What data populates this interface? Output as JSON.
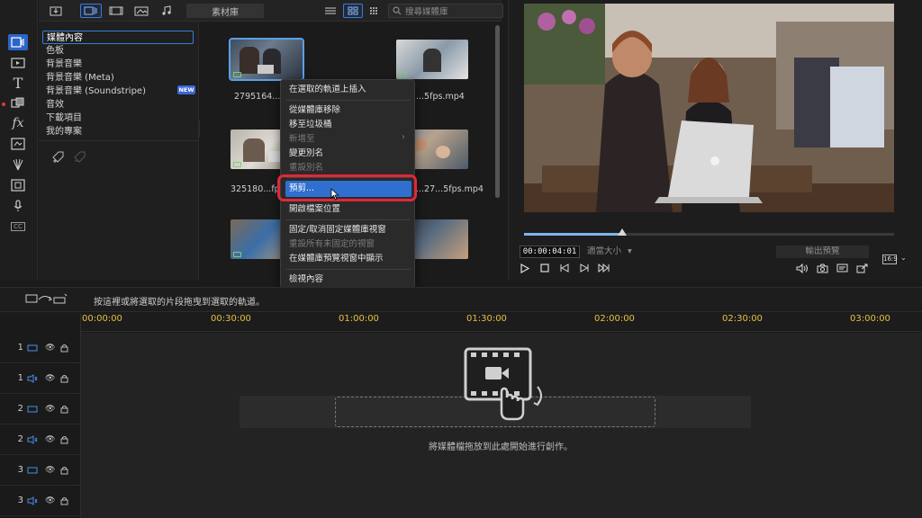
{
  "media_toolbar": {
    "library_label": "素材庫",
    "search_placeholder": "搜尋媒體庫"
  },
  "tree": {
    "items": [
      "媒體內容",
      "色板",
      "背景音樂",
      "背景音樂 (Meta)",
      "背景音樂 (Soundstripe)",
      "音效",
      "下載項目",
      "我的專案"
    ],
    "badge": "NEW"
  },
  "media": {
    "labels": [
      "2795164...fp",
      "...5fps.mp4",
      "325180...fps",
      "...27...5fps.mp4"
    ]
  },
  "context_menu": {
    "items": [
      {
        "label": "在選取的軌道上插入",
        "disabled": false
      },
      {
        "label": "從媒體庫移除",
        "disabled": false
      },
      {
        "label": "移至垃圾桶",
        "disabled": false
      },
      {
        "label": "新增至",
        "disabled": true
      },
      {
        "label": "變更別名",
        "disabled": false
      },
      {
        "label": "重設別名",
        "disabled": true
      },
      {
        "label": "預剪...",
        "disabled": false,
        "highlighted": true
      },
      {
        "label": "開啟檔案位置",
        "disabled": false
      },
      {
        "label": "固定/取消固定媒體庫視窗",
        "disabled": false
      },
      {
        "label": "重設所有未固定的視窗",
        "disabled": true
      },
      {
        "label": "在媒體庫預覽視窗中顯示",
        "disabled": false
      },
      {
        "label": "檢視內容",
        "disabled": false
      }
    ]
  },
  "preview": {
    "timecode": "00:00:04:01",
    "fit_label": "適當大小",
    "export_label": "輸出預覽",
    "aspect": "16:9",
    "progress": 0.265
  },
  "timeline": {
    "hint": "按這裡或將選取的片段拖曳到選取的軌道。",
    "ticks": [
      "00:00:00",
      "00:30:00",
      "01:00:00",
      "01:30:00",
      "02:00:00",
      "02:30:00",
      "03:00:00"
    ],
    "tracks": [
      "1",
      "1",
      "2",
      "2",
      "3",
      "3"
    ],
    "drop_hint": "將媒體檔拖放到此處開始進行創作。"
  },
  "colors": {
    "accent": "#2f6fd0",
    "highlight_ring": "#e0283a",
    "ruler_text": "#e5c040"
  }
}
